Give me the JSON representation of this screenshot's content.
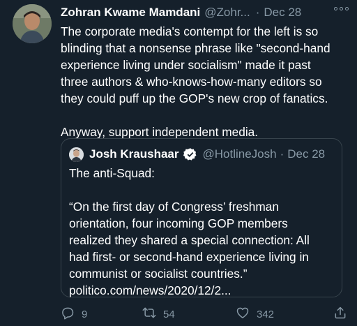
{
  "tweet": {
    "author_name": "Zohran Kwame Mamdani",
    "author_handle": "@Zohr...",
    "separator": "·",
    "date": "Dec 28",
    "text_lines": [
      "The corporate media's contempt for the left is so",
      "blinding that a nonsense phrase like \"second-hand",
      "experience living under socialism\" made it past",
      "three authors & who-knows-how-many editors so",
      "they could puff up the GOP's new crop of fanatics."
    ],
    "text_line2": "Anyway, support independent media.",
    "more_icon": "more-horizontal-icon"
  },
  "quote": {
    "author_name": "Josh Kraushaar",
    "verified_icon": "verified-badge-icon",
    "author_handle": "@HotlineJosh",
    "separator": "·",
    "date": "Dec 28",
    "lines": [
      "The anti-Squad:",
      "",
      "“On the first day of Congress’ freshman",
      "orientation, four incoming GOP members",
      "realized they shared a special connection: All",
      "had first- or second-hand experience living in",
      "communist or socialist countries.”",
      "politico.com/news/2020/12/2..."
    ]
  },
  "actions": {
    "reply_count": "9",
    "retweet_count": "54",
    "like_count": "342"
  },
  "colors": {
    "background": "#15202b",
    "secondary_text": "#8899a6",
    "border": "#38444d"
  }
}
